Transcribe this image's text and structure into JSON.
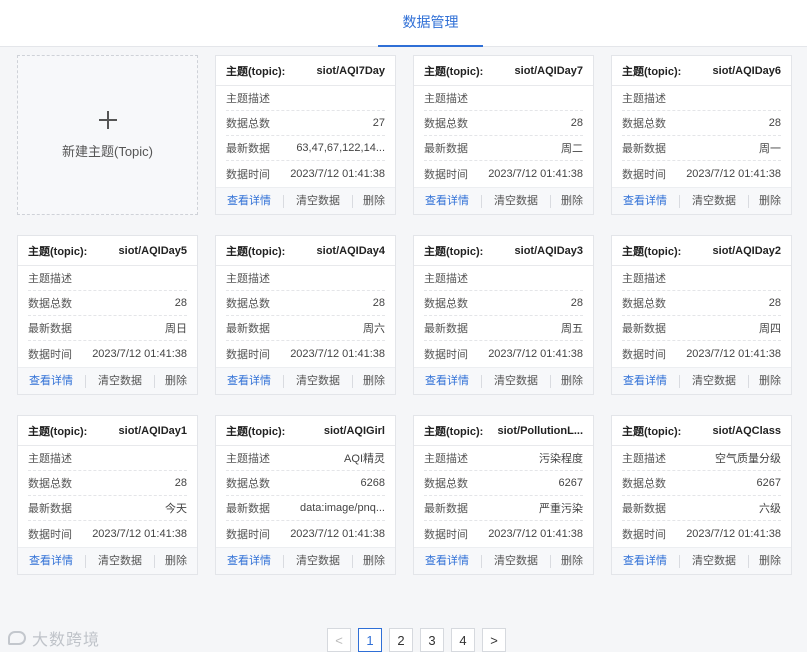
{
  "header": {
    "active_tab": "数据管理"
  },
  "new_topic": {
    "label": "新建主题(Topic)"
  },
  "labels": {
    "topic": "主题(topic):",
    "description": "主题描述",
    "total": "数据总数",
    "latest": "最新数据",
    "time": "数据时间"
  },
  "actions": {
    "view": "查看详情",
    "clear": "清空数据",
    "delete": "删除"
  },
  "cards": [
    {
      "topic": "siot/AQI7Day",
      "description": "",
      "total": "27",
      "latest": "63,47,67,122,14...",
      "time": "2023/7/12 01:41:38"
    },
    {
      "topic": "siot/AQIDay7",
      "description": "",
      "total": "28",
      "latest": "周二",
      "time": "2023/7/12 01:41:38"
    },
    {
      "topic": "siot/AQIDay6",
      "description": "",
      "total": "28",
      "latest": "周一",
      "time": "2023/7/12 01:41:38"
    },
    {
      "topic": "siot/AQIDay5",
      "description": "",
      "total": "28",
      "latest": "周日",
      "time": "2023/7/12 01:41:38"
    },
    {
      "topic": "siot/AQIDay4",
      "description": "",
      "total": "28",
      "latest": "周六",
      "time": "2023/7/12 01:41:38"
    },
    {
      "topic": "siot/AQIDay3",
      "description": "",
      "total": "28",
      "latest": "周五",
      "time": "2023/7/12 01:41:38"
    },
    {
      "topic": "siot/AQIDay2",
      "description": "",
      "total": "28",
      "latest": "周四",
      "time": "2023/7/12 01:41:38"
    },
    {
      "topic": "siot/AQIDay1",
      "description": "",
      "total": "28",
      "latest": "今天",
      "time": "2023/7/12 01:41:38"
    },
    {
      "topic": "siot/AQIGirl",
      "description": "AQI精灵",
      "total": "6268",
      "latest": "data:image/pnq...",
      "time": "2023/7/12 01:41:38"
    },
    {
      "topic": "siot/PollutionL...",
      "description": "污染程度",
      "total": "6267",
      "latest": "严重污染",
      "time": "2023/7/12 01:41:38"
    },
    {
      "topic": "siot/AQClass",
      "description": "空气质量分级",
      "total": "6267",
      "latest": "六级",
      "time": "2023/7/12 01:41:38"
    }
  ],
  "pagination": {
    "pages": [
      "1",
      "2",
      "3",
      "4"
    ],
    "current": "1",
    "prev": "<",
    "next": ">"
  },
  "watermark": "大数跨境",
  "colors": {
    "accent": "#2f6fd6",
    "background": "#f5f6f8",
    "card": "#ffffff"
  }
}
